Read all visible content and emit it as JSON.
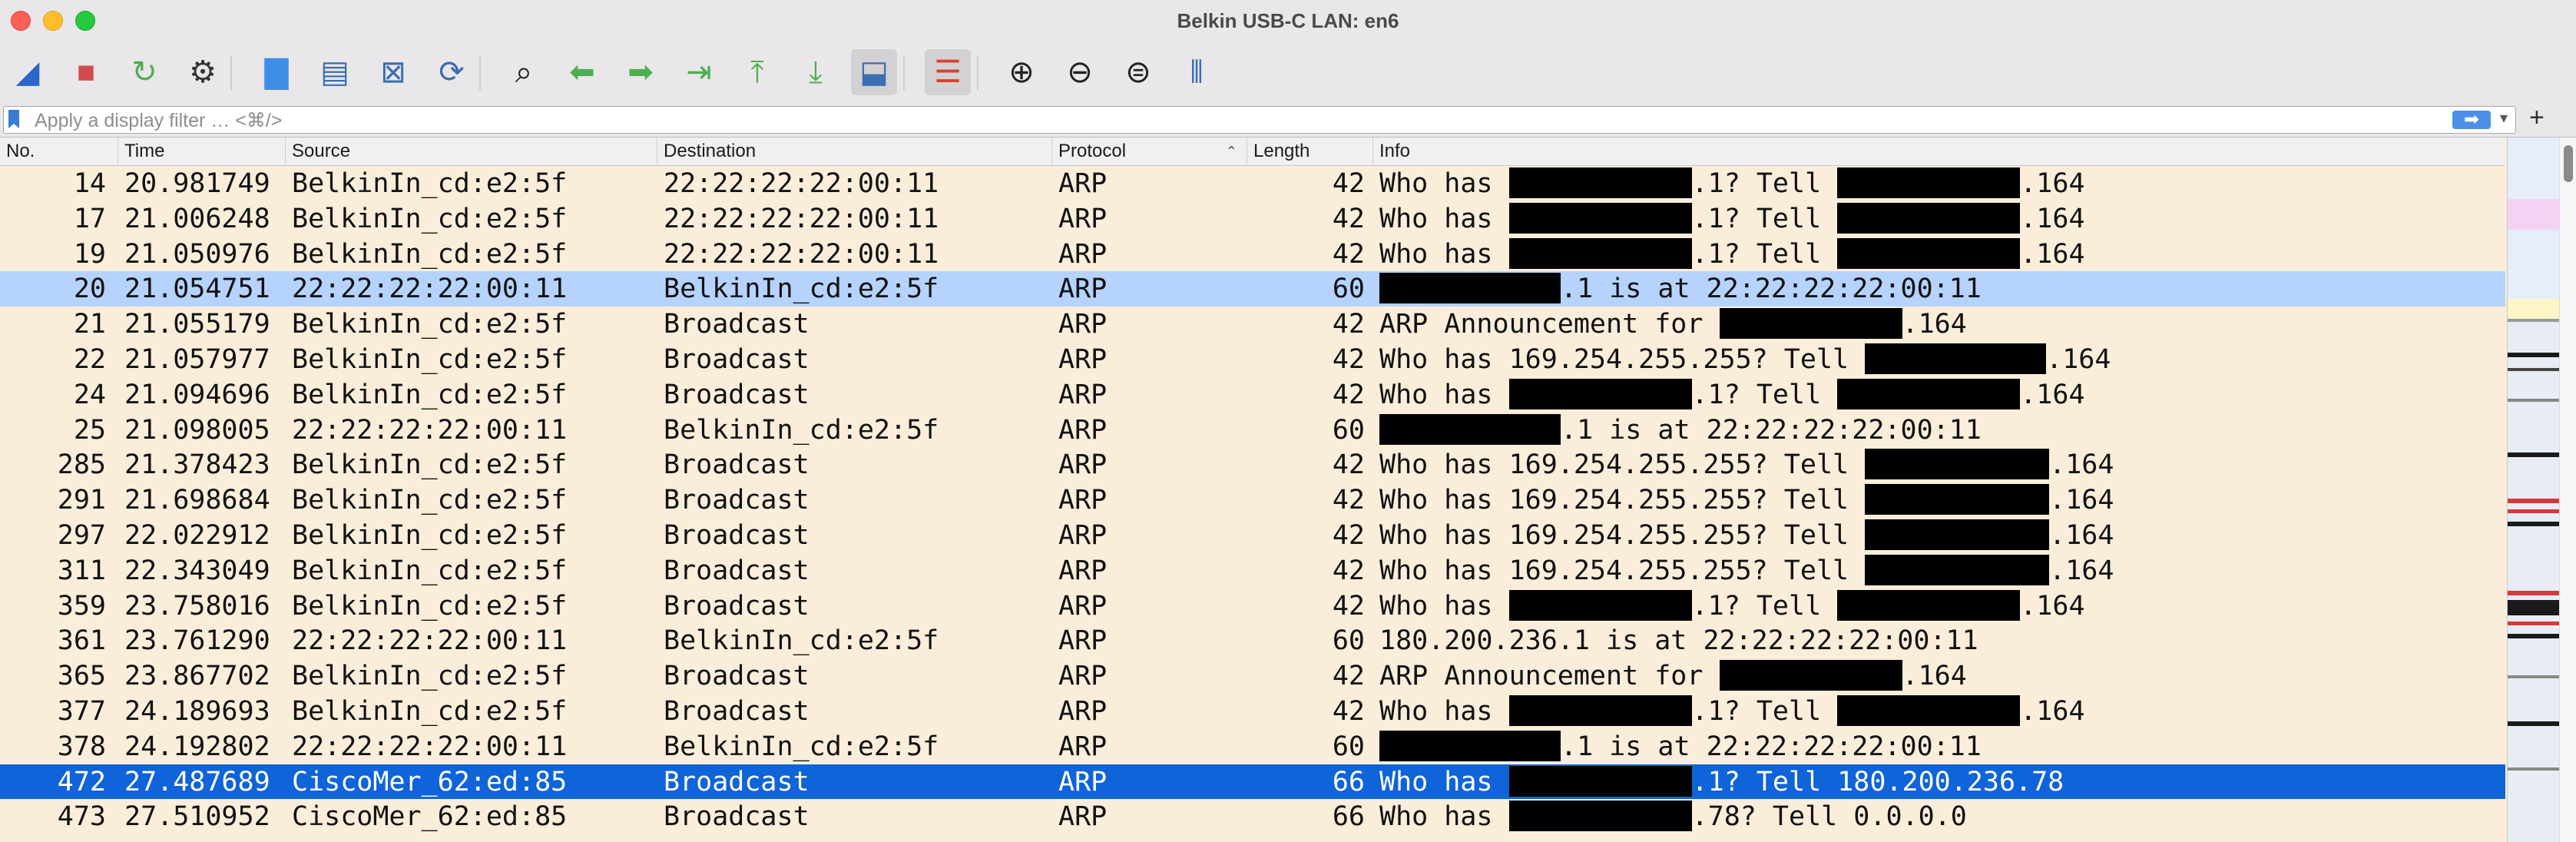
{
  "window": {
    "title": "Belkin USB-C LAN: en6"
  },
  "toolbar": {
    "buttons": [
      {
        "name": "start-capture-icon",
        "glyph": "◢",
        "color": "#2c66c9"
      },
      {
        "name": "stop-capture-icon",
        "glyph": "■",
        "color": "#d34b4b"
      },
      {
        "name": "restart-capture-icon",
        "glyph": "↻",
        "color": "#4caf50"
      },
      {
        "name": "capture-options-icon",
        "glyph": "⚙",
        "color": "#333333"
      },
      {
        "name": "open-file-icon",
        "glyph": "▇",
        "color": "#3d8fe6"
      },
      {
        "name": "save-file-icon",
        "glyph": "▤",
        "color": "#3a6fb0"
      },
      {
        "name": "close-file-icon",
        "glyph": "⊠",
        "color": "#3a6fb0"
      },
      {
        "name": "reload-file-icon",
        "glyph": "⟳",
        "color": "#3a6fb0"
      },
      {
        "name": "find-packet-icon",
        "glyph": "⌕",
        "color": "#222222"
      },
      {
        "name": "go-back-icon",
        "glyph": "⬅",
        "color": "#4caf50"
      },
      {
        "name": "go-forward-icon",
        "glyph": "➡",
        "color": "#4caf50"
      },
      {
        "name": "go-to-packet-icon",
        "glyph": "⇥",
        "color": "#4caf50"
      },
      {
        "name": "first-packet-icon",
        "glyph": "⤒",
        "color": "#4caf50"
      },
      {
        "name": "last-packet-icon",
        "glyph": "⤓",
        "color": "#4caf50"
      },
      {
        "name": "autoscroll-icon",
        "glyph": "⬓",
        "color": "#3a6fb0"
      },
      {
        "name": "colorize-icon",
        "glyph": "☰",
        "color": "#d6442a"
      },
      {
        "name": "zoom-in-icon",
        "glyph": "⊕",
        "color": "#222222"
      },
      {
        "name": "zoom-out-icon",
        "glyph": "⊖",
        "color": "#222222"
      },
      {
        "name": "zoom-normal-icon",
        "glyph": "⊜",
        "color": "#222222"
      },
      {
        "name": "resize-columns-icon",
        "glyph": "⫴",
        "color": "#3a6fb0"
      }
    ]
  },
  "filter": {
    "placeholder": "Apply a display filter … <⌘/>",
    "apply_glyph": "➡",
    "dropdown_glyph": "▾",
    "add_glyph": "+"
  },
  "columns": {
    "no": "No.",
    "time": "Time",
    "source": "Source",
    "destination": "Destination",
    "protocol": "Protocol",
    "length": "Length",
    "info": "Info",
    "sort_glyph": "⌃"
  },
  "packets": [
    {
      "no": "14",
      "time": "20.981749",
      "src": "BelkinIn_cd:e2:5f",
      "dst": "22:22:22:22:00:11",
      "proto": "ARP",
      "len": "42",
      "info": [
        "Who has ",
        {
          "r": 238
        },
        ".1? Tell ",
        {
          "r": 238
        },
        ".164"
      ]
    },
    {
      "no": "17",
      "time": "21.006248",
      "src": "BelkinIn_cd:e2:5f",
      "dst": "22:22:22:22:00:11",
      "proto": "ARP",
      "len": "42",
      "info": [
        "Who has ",
        {
          "r": 238
        },
        ".1? Tell ",
        {
          "r": 238
        },
        ".164"
      ]
    },
    {
      "no": "19",
      "time": "21.050976",
      "src": "BelkinIn_cd:e2:5f",
      "dst": "22:22:22:22:00:11",
      "proto": "ARP",
      "len": "42",
      "info": [
        "Who has ",
        {
          "r": 238
        },
        ".1? Tell ",
        {
          "r": 238
        },
        ".164"
      ]
    },
    {
      "no": "20",
      "time": "21.054751",
      "src": "22:22:22:22:00:11",
      "dst": "BelkinIn_cd:e2:5f",
      "proto": "ARP",
      "len": "60",
      "info": [
        {
          "r": 236
        },
        ".1 is at 22:22:22:22:00:11"
      ],
      "style": "sel-light"
    },
    {
      "no": "21",
      "time": "21.055179",
      "src": "BelkinIn_cd:e2:5f",
      "dst": "Broadcast",
      "proto": "ARP",
      "len": "42",
      "info": [
        "ARP Announcement for ",
        {
          "r": 238
        },
        ".164"
      ]
    },
    {
      "no": "22",
      "time": "21.057977",
      "src": "BelkinIn_cd:e2:5f",
      "dst": "Broadcast",
      "proto": "ARP",
      "len": "42",
      "info": [
        "Who has 169.254.255.255? Tell ",
        {
          "r": 236
        },
        ".164"
      ]
    },
    {
      "no": "24",
      "time": "21.094696",
      "src": "BelkinIn_cd:e2:5f",
      "dst": "Broadcast",
      "proto": "ARP",
      "len": "42",
      "info": [
        "Who has ",
        {
          "r": 238
        },
        ".1? Tell ",
        {
          "r": 238
        },
        ".164"
      ]
    },
    {
      "no": "25",
      "time": "21.098005",
      "src": "22:22:22:22:00:11",
      "dst": "BelkinIn_cd:e2:5f",
      "proto": "ARP",
      "len": "60",
      "info": [
        {
          "r": 236
        },
        ".1 is at 22:22:22:22:00:11"
      ]
    },
    {
      "no": "285",
      "time": "21.378423",
      "src": "BelkinIn_cd:e2:5f",
      "dst": "Broadcast",
      "proto": "ARP",
      "len": "42",
      "info": [
        "Who has 169.254.255.255? Tell ",
        {
          "r": 240
        },
        ".164"
      ]
    },
    {
      "no": "291",
      "time": "21.698684",
      "src": "BelkinIn_cd:e2:5f",
      "dst": "Broadcast",
      "proto": "ARP",
      "len": "42",
      "info": [
        "Who has 169.254.255.255? Tell ",
        {
          "r": 240
        },
        ".164"
      ]
    },
    {
      "no": "297",
      "time": "22.022912",
      "src": "BelkinIn_cd:e2:5f",
      "dst": "Broadcast",
      "proto": "ARP",
      "len": "42",
      "info": [
        "Who has 169.254.255.255? Tell ",
        {
          "r": 240
        },
        ".164"
      ]
    },
    {
      "no": "311",
      "time": "22.343049",
      "src": "BelkinIn_cd:e2:5f",
      "dst": "Broadcast",
      "proto": "ARP",
      "len": "42",
      "info": [
        "Who has 169.254.255.255? Tell ",
        {
          "r": 240
        },
        ".164"
      ]
    },
    {
      "no": "359",
      "time": "23.758016",
      "src": "BelkinIn_cd:e2:5f",
      "dst": "Broadcast",
      "proto": "ARP",
      "len": "42",
      "info": [
        "Who has ",
        {
          "r": 238
        },
        ".1? Tell ",
        {
          "r": 238
        },
        ".164"
      ]
    },
    {
      "no": "361",
      "time": "23.761290",
      "src": "22:22:22:22:00:11",
      "dst": "BelkinIn_cd:e2:5f",
      "proto": "ARP",
      "len": "60",
      "info": [
        "180.200.236.1 is at 22:22:22:22:00:11"
      ]
    },
    {
      "no": "365",
      "time": "23.867702",
      "src": "BelkinIn_cd:e2:5f",
      "dst": "Broadcast",
      "proto": "ARP",
      "len": "42",
      "info": [
        "ARP Announcement for ",
        {
          "r": 238
        },
        ".164"
      ]
    },
    {
      "no": "377",
      "time": "24.189693",
      "src": "BelkinIn_cd:e2:5f",
      "dst": "Broadcast",
      "proto": "ARP",
      "len": "42",
      "info": [
        "Who has ",
        {
          "r": 238
        },
        ".1? Tell ",
        {
          "r": 238
        },
        ".164"
      ]
    },
    {
      "no": "378",
      "time": "24.192802",
      "src": "22:22:22:22:00:11",
      "dst": "BelkinIn_cd:e2:5f",
      "proto": "ARP",
      "len": "60",
      "info": [
        {
          "r": 236
        },
        ".1 is at 22:22:22:22:00:11"
      ]
    },
    {
      "no": "472",
      "time": "27.487689",
      "src": "CiscoMer_62:ed:85",
      "dst": "Broadcast",
      "proto": "ARP",
      "len": "66",
      "info": [
        "Who has ",
        {
          "r": 238
        },
        ".1? Tell 180.200.236.78"
      ],
      "style": "sel"
    },
    {
      "no": "473",
      "time": "27.510952",
      "src": "CiscoMer_62:ed:85",
      "dst": "Broadcast",
      "proto": "ARP",
      "len": "66",
      "info": [
        "Who has ",
        {
          "r": 238
        },
        ".78? Tell 0.0.0.0"
      ]
    }
  ],
  "minimap": {
    "bands": [
      {
        "t": 0,
        "h": 80,
        "c": "#e6eefb"
      },
      {
        "t": 80,
        "h": 40,
        "c": "#f4d2f3"
      },
      {
        "t": 120,
        "h": 90,
        "c": "#e6eefb"
      },
      {
        "t": 210,
        "h": 26,
        "c": "#fdf6c8"
      },
      {
        "t": 236,
        "h": 4,
        "c": "#9a9a9a"
      },
      {
        "t": 280,
        "h": 6,
        "c": "#1a1a1a"
      },
      {
        "t": 300,
        "h": 4,
        "c": "#444"
      },
      {
        "t": 340,
        "h": 4,
        "c": "#888"
      },
      {
        "t": 410,
        "h": 6,
        "c": "#1a1a1a"
      },
      {
        "t": 470,
        "h": 6,
        "c": "#d43b3b"
      },
      {
        "t": 484,
        "h": 5,
        "c": "#d43b3b"
      },
      {
        "t": 500,
        "h": 6,
        "c": "#1a1a1a"
      },
      {
        "t": 590,
        "h": 6,
        "c": "#d43b3b"
      },
      {
        "t": 602,
        "h": 20,
        "c": "#1a1a1a"
      },
      {
        "t": 630,
        "h": 5,
        "c": "#d43b3b"
      },
      {
        "t": 646,
        "h": 6,
        "c": "#1a1a1a"
      },
      {
        "t": 700,
        "h": 4,
        "c": "#888"
      },
      {
        "t": 760,
        "h": 6,
        "c": "#1a1a1a"
      },
      {
        "t": 820,
        "h": 4,
        "c": "#888"
      }
    ]
  }
}
